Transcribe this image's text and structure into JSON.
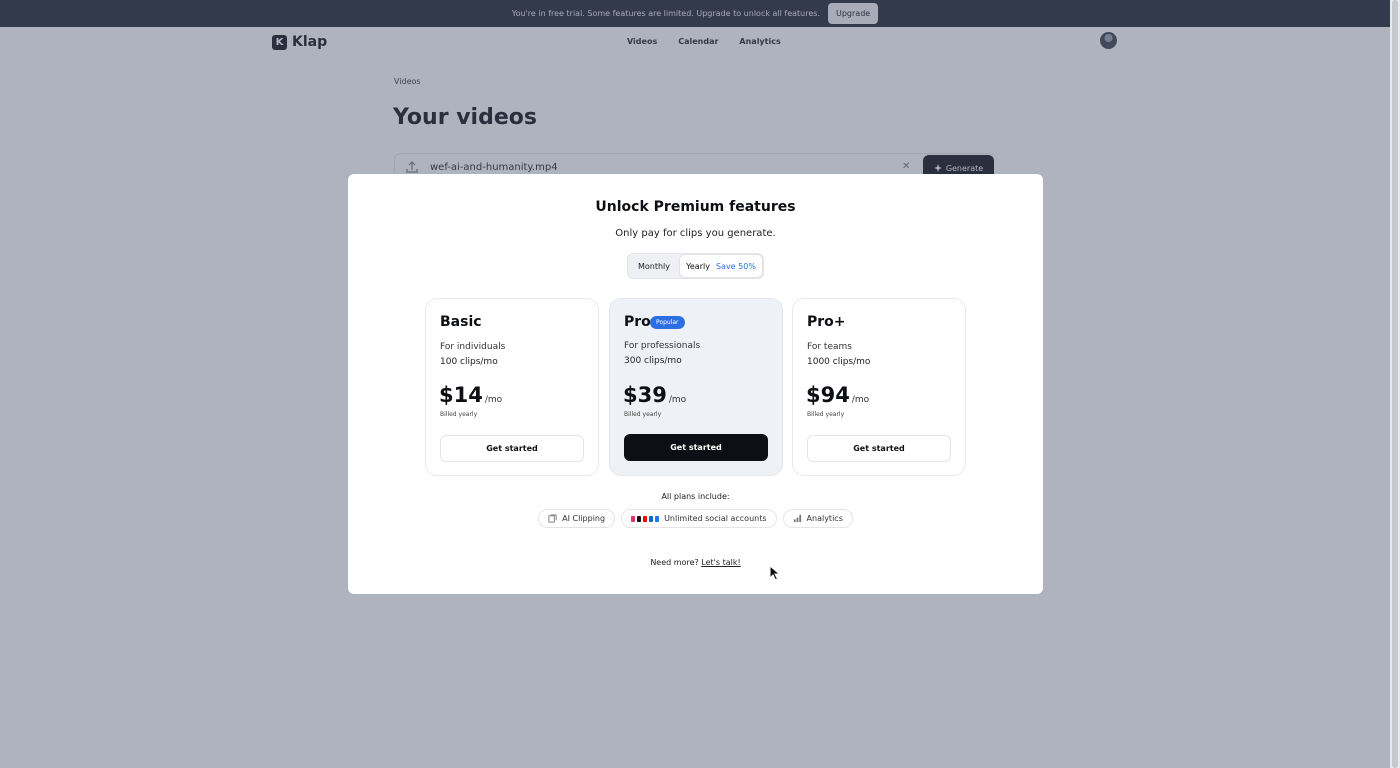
{
  "trial_bar": {
    "message": "You're in free trial. Some features are limited. Upgrade to unlock all features.",
    "upgrade_label": "Upgrade"
  },
  "nav": {
    "brand": "Klap",
    "links": [
      "Videos",
      "Calendar",
      "Analytics"
    ]
  },
  "page": {
    "breadcrumb": "Videos",
    "title": "Your videos",
    "file_name": "wef-ai-and-humanity.mp4",
    "generate_label": "Generate"
  },
  "modal": {
    "title": "Unlock Premium features",
    "subtitle": "Only pay for clips you generate.",
    "toggle": {
      "monthly_label": "Monthly",
      "yearly_label": "Yearly",
      "save_label": "Save 50%",
      "selected": "Yearly"
    },
    "plans": [
      {
        "name": "Basic",
        "badge": "",
        "for": "For individuals",
        "clips": "100 clips",
        "clips_unit": "/mo",
        "price": "$14",
        "price_unit": "/mo",
        "billed": "Billed yearly",
        "cta": "Get started"
      },
      {
        "name": "Pro",
        "badge": "Popular",
        "for": "For professionals",
        "clips": "300 clips",
        "clips_unit": "/mo",
        "price": "$39",
        "price_unit": "/mo",
        "billed": "Billed yearly",
        "cta": "Get started"
      },
      {
        "name": "Pro+",
        "badge": "",
        "for": "For teams",
        "clips": "1000 clips",
        "clips_unit": "/mo",
        "price": "$94",
        "price_unit": "/mo",
        "billed": "Billed yearly",
        "cta": "Get started"
      }
    ],
    "includes_title": "All plans include:",
    "features": [
      "AI Clipping",
      "Unlimited social accounts",
      "Analytics"
    ],
    "need_more": "Need more?",
    "talk_link": "Let's talk!"
  },
  "colors": {
    "accent": "#2c6fe0",
    "dark": "#0d0f14",
    "trial_bar": "#1f2430"
  }
}
